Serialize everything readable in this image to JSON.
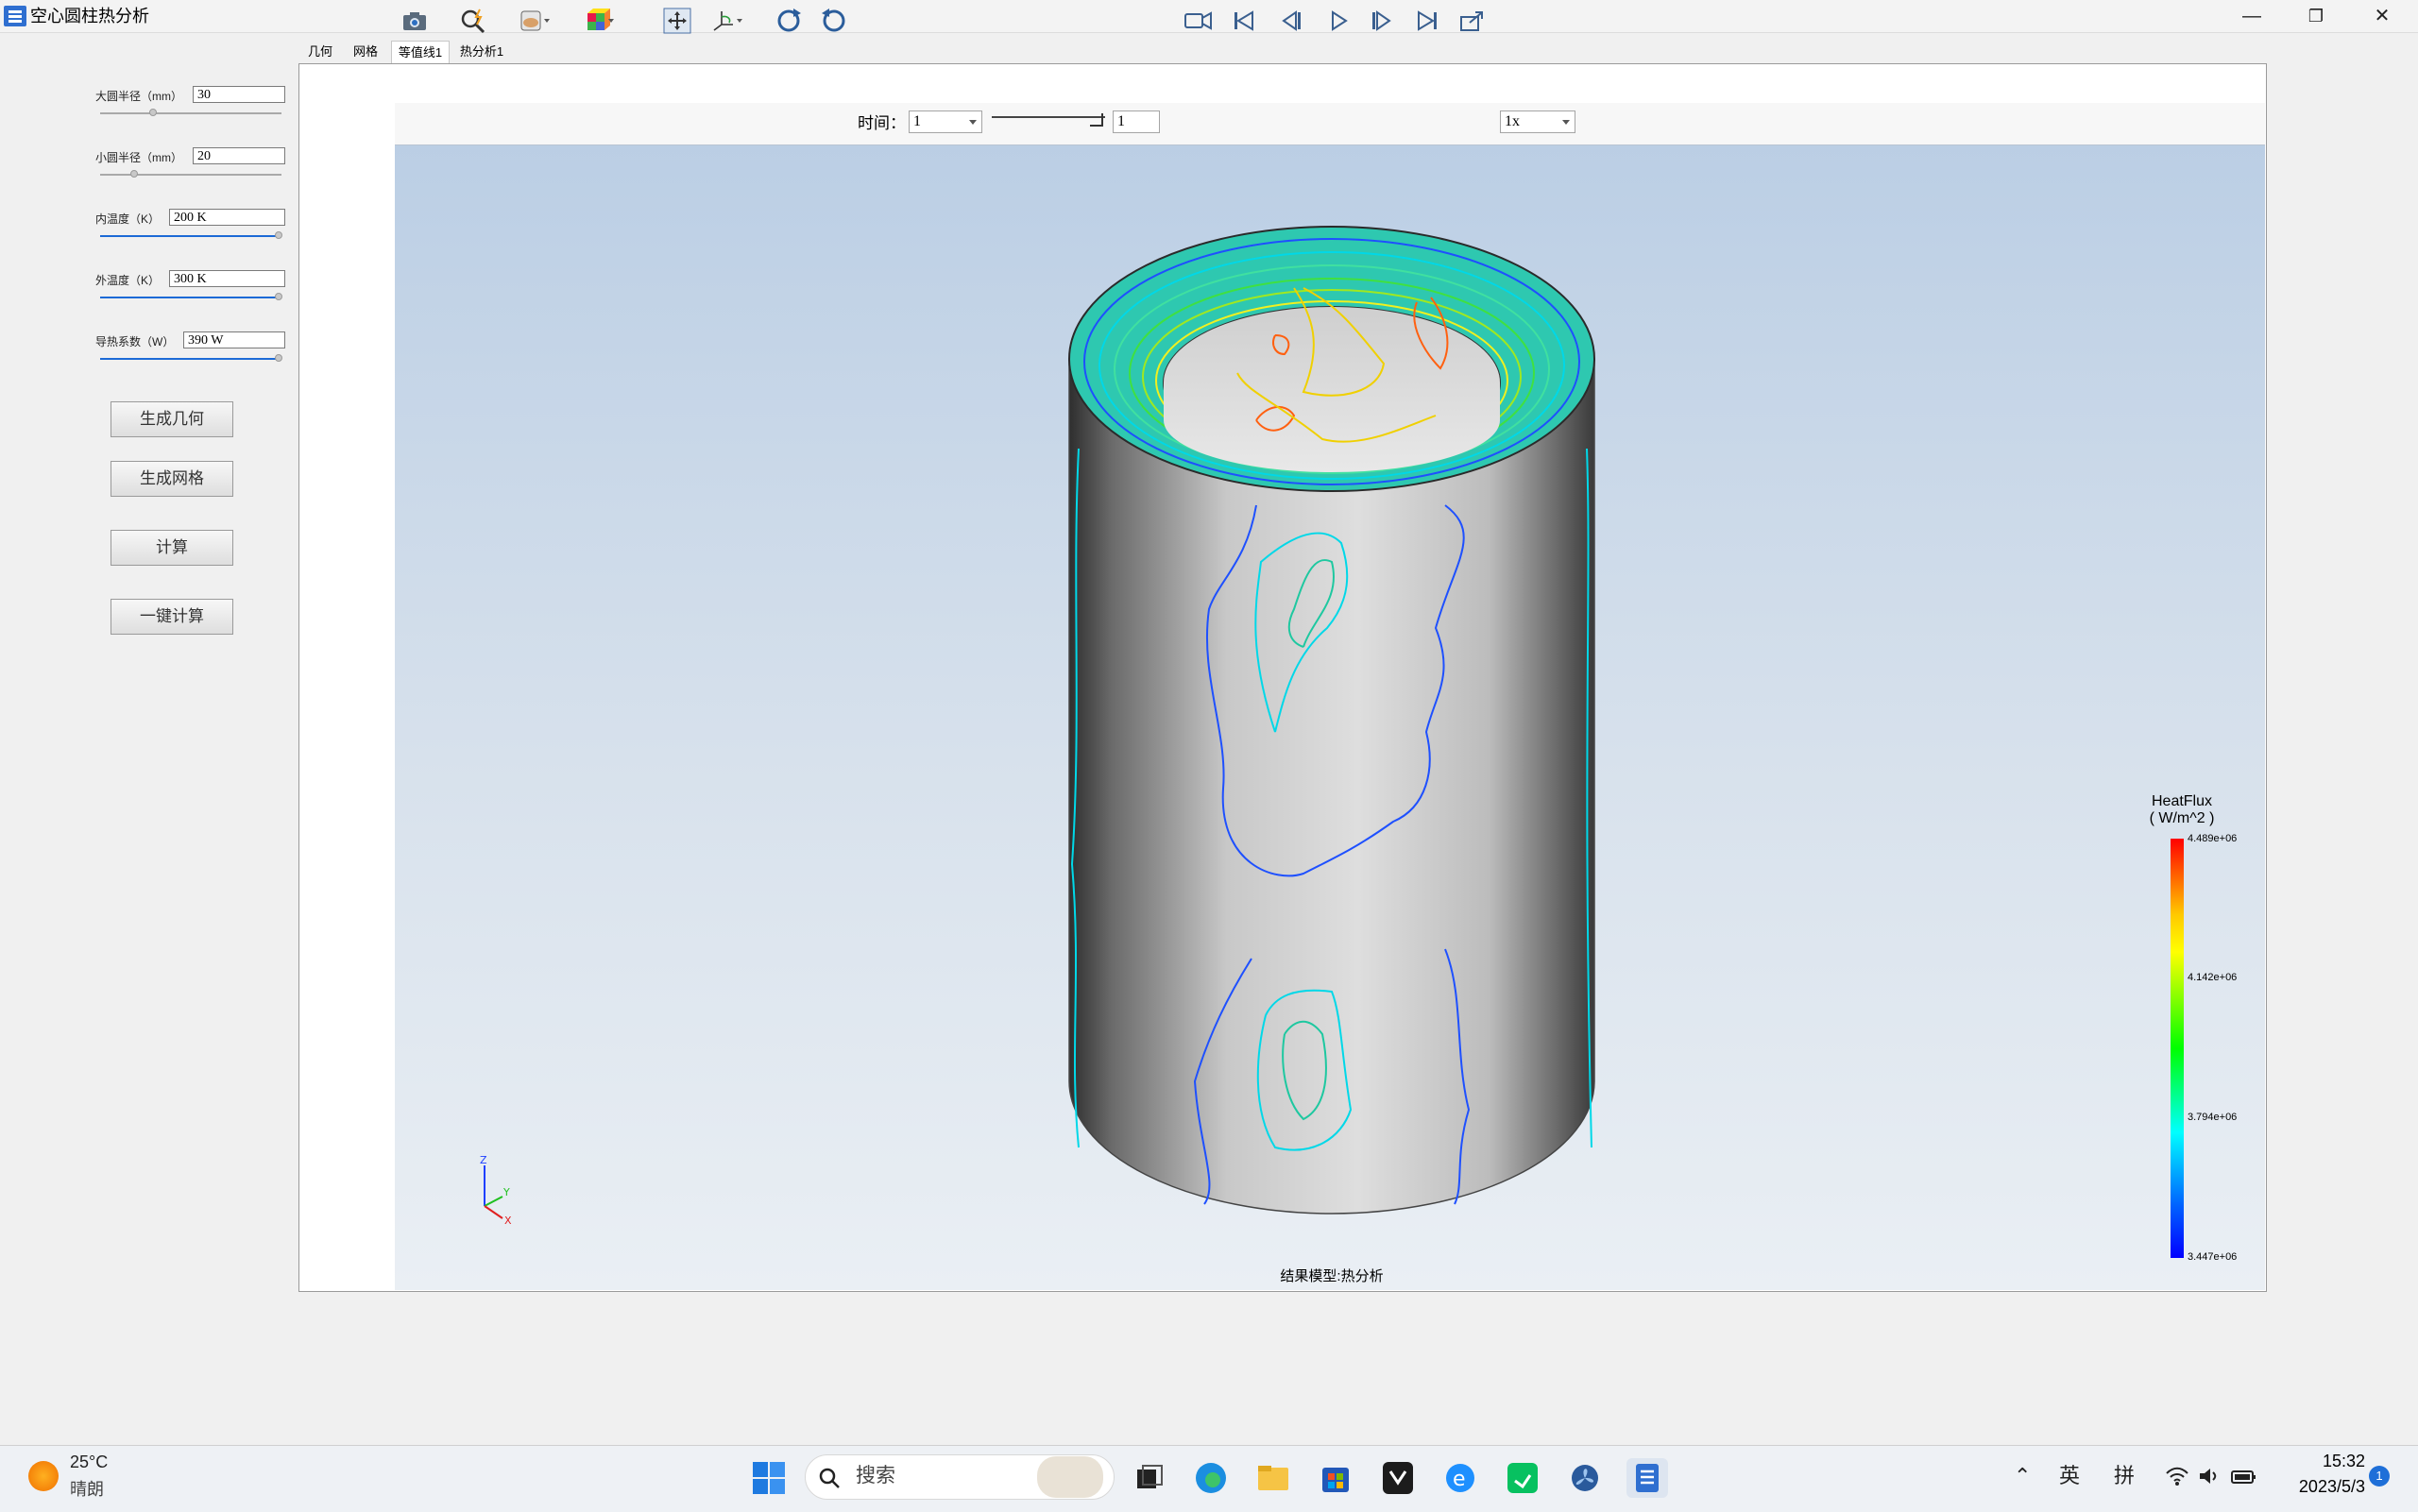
{
  "window": {
    "title": "空心圆柱热分析",
    "minimize_glyph": "—",
    "maximize_glyph": "❐",
    "close_glyph": "✕"
  },
  "params": [
    {
      "label": "大圆半径（mm）",
      "value": "30",
      "slider_fraction": 0.3
    },
    {
      "label": "小圆半径（mm）",
      "value": "20",
      "slider_fraction": 0.2
    },
    {
      "label": "内温度（K）",
      "value": "200 K",
      "slider_fraction": 1.0
    },
    {
      "label": "外温度（K）",
      "value": "300 K",
      "slider_fraction": 1.0
    },
    {
      "label": "导热系数（W）",
      "value": "390 W",
      "slider_fraction": 1.0
    }
  ],
  "buttons": {
    "geometry": "生成几何",
    "mesh": "生成网格",
    "compute": "计算",
    "one_click": "一键计算"
  },
  "tabs": [
    {
      "label": "几何",
      "active": false
    },
    {
      "label": "网格",
      "active": false
    },
    {
      "label": "等值线1",
      "active": true
    },
    {
      "label": "热分析1",
      "active": false
    }
  ],
  "toolbar": {
    "icons": [
      "camera-icon",
      "zoom-icon",
      "display-mode-icon",
      "color-cube-icon",
      "fit-view-icon",
      "axis-orient-icon",
      "rotate-cw-icon",
      "rotate-ccw-icon",
      "record-video-icon",
      "first-frame-icon",
      "prev-frame-icon",
      "play-icon",
      "next-frame-icon",
      "last-frame-icon",
      "export-icon"
    ],
    "time_label": "时间：",
    "time_value": "1",
    "frame_value": "1",
    "speed_value": "1x"
  },
  "legend": {
    "title": "HeatFlux",
    "unit": "( W/m^2 )",
    "values": [
      "4.489e+06",
      "4.142e+06",
      "3.794e+06",
      "3.447e+06"
    ],
    "colors": [
      "#ff0000",
      "#ffff00",
      "#00ff00",
      "#00ffff",
      "#0000ff"
    ]
  },
  "triad": {
    "z": "Z",
    "y": "Y",
    "x": "X"
  },
  "result_caption": "结果模型:热分析",
  "taskbar": {
    "weather_temp": "25°C",
    "weather_desc": "晴朗",
    "search_placeholder": "搜索",
    "ime_lang": "英",
    "ime_mode": "拼",
    "time": "15:32",
    "date": "2023/5/3",
    "notification_count": "1"
  }
}
